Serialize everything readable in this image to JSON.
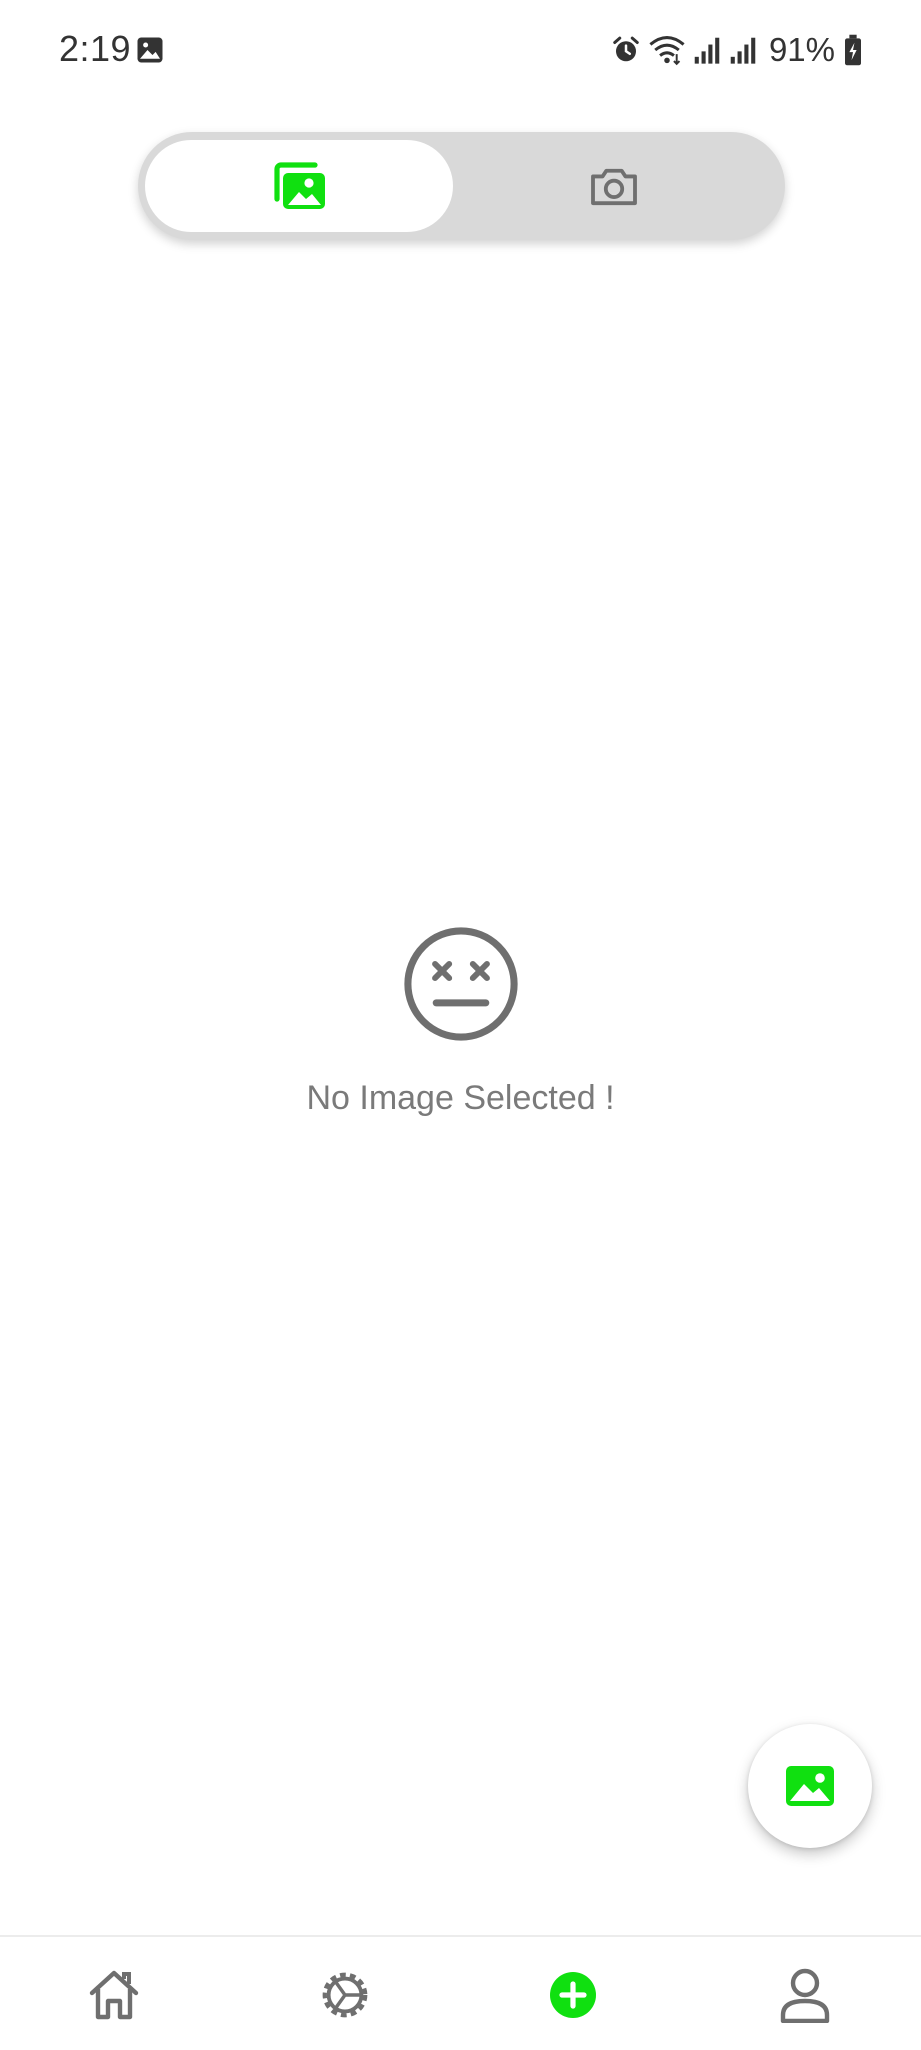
{
  "status_bar": {
    "time": "2:19",
    "battery": "91%"
  },
  "toggle": {
    "options": [
      {
        "icon": "gallery-icon",
        "selected": true
      },
      {
        "icon": "camera-icon",
        "selected": false
      }
    ]
  },
  "empty_state": {
    "icon": "dizzy-face-icon",
    "message": "No Image Selected !"
  },
  "fab": {
    "icon": "image-add-icon"
  },
  "bottom_nav": {
    "items": [
      {
        "icon": "home-icon"
      },
      {
        "icon": "settings-icon"
      },
      {
        "icon": "add-icon",
        "active": true
      },
      {
        "icon": "profile-icon"
      }
    ]
  },
  "colors": {
    "accent": "#10e010",
    "icon_gray": "#6f6f6f",
    "toggle_bg": "#d9d9d9",
    "text_gray": "#7a7a7a"
  }
}
